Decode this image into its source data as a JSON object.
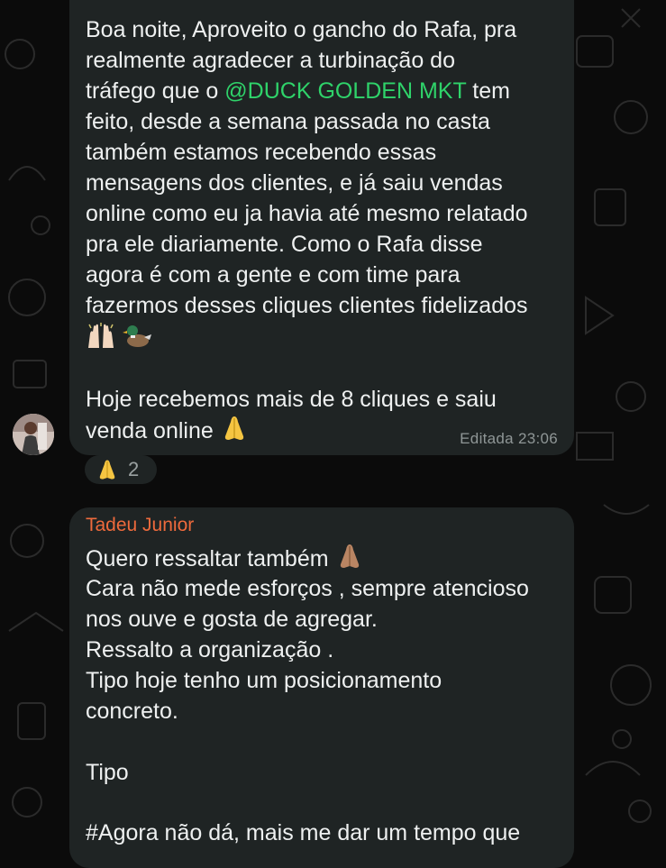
{
  "messages": [
    {
      "lines_before_mention": "Boa noite, Aproveito o gancho do Rafa, pra",
      "line2": "realmente agradecer a turbinação do",
      "line3_pre": "tráfego que o ",
      "mention": "@DUCK GOLDEN MKT",
      "line3_post": " tem",
      "line4": "feito, desde a semana passada no casta",
      "line5": "também estamos recebendo essas",
      "line6": "mensagens dos clientes, e já saiu vendas",
      "line7": "online como eu ja havia até mesmo relatado",
      "line8": "pra ele diariamente. Como o Rafa disse",
      "line9": "agora é com a gente e com time para",
      "line10": "fazermos desses cliques clientes fidelizados",
      "line11": "Hoje recebemos mais de 8 cliques e saiu",
      "line12": "venda online",
      "time": "Editada 23:06",
      "reaction_count": "2"
    },
    {
      "sender": "Tadeu Junior",
      "line1": "Quero ressaltar também",
      "line2": "Cara não mede esforços , sempre atencioso",
      "line3": "nos ouve e gosta de agregar.",
      "line4": "Ressalto a organização .",
      "line5": "Tipo hoje tenho um posicionamento",
      "line6": "concreto.",
      "line7": "Tipo",
      "line8": "#Agora não dá, mais me dar um tempo que"
    }
  ],
  "colors": {
    "bubble": "#1f2424",
    "mention": "#2fd36a",
    "sender": "#ee6a3c",
    "background": "#0b0b0b"
  },
  "icons": [
    "raising-hands-emoji",
    "duck-emoji",
    "praying-hands-emoji"
  ]
}
